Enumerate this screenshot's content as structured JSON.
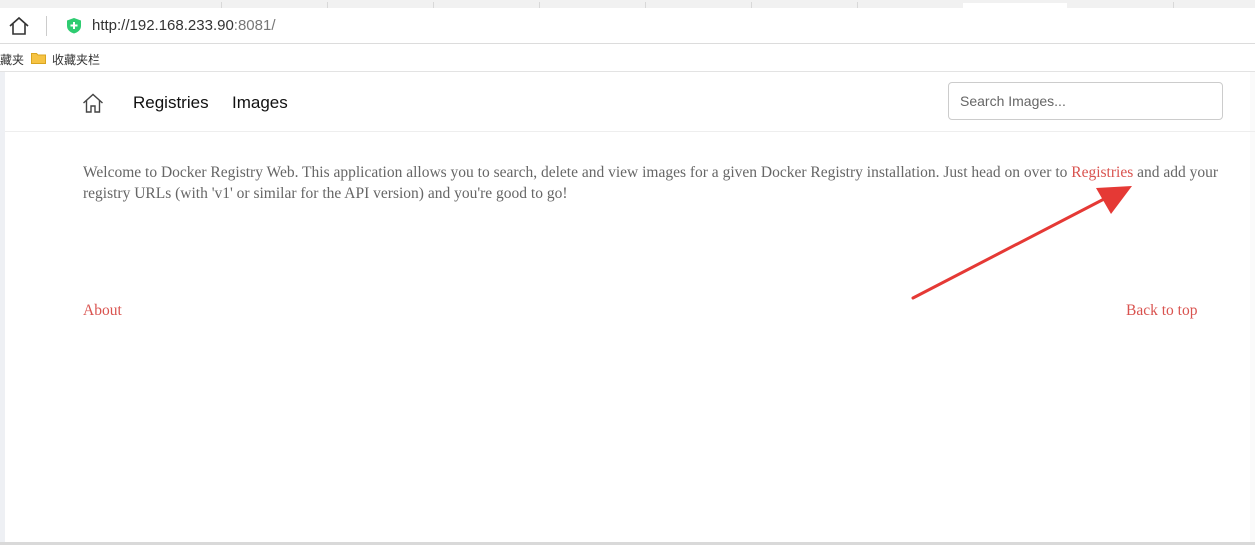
{
  "browser": {
    "url_host": "http://192.168.233.90",
    "url_port": ":8081/",
    "bookmarks_partial": "藏夹",
    "bookmarks_folder_label": "收藏夹栏"
  },
  "nav": {
    "registries_label": "Registries",
    "images_label": "Images",
    "search_placeholder": "Search Images..."
  },
  "content": {
    "welcome_before": "Welcome to Docker Registry Web. This application allows you to search, delete and view images for a given Docker Registry installation. Just head on over to ",
    "welcome_link": "Registries",
    "welcome_after": " and add your registry URLs (with 'v1' or similar for the API version) and you're good to go!"
  },
  "footer": {
    "about_label": "About",
    "back_to_top_label": "Back to top"
  },
  "colors": {
    "accent": "#d9534f",
    "annotation_arrow": "#e53935",
    "shield": "#2ecc71"
  }
}
